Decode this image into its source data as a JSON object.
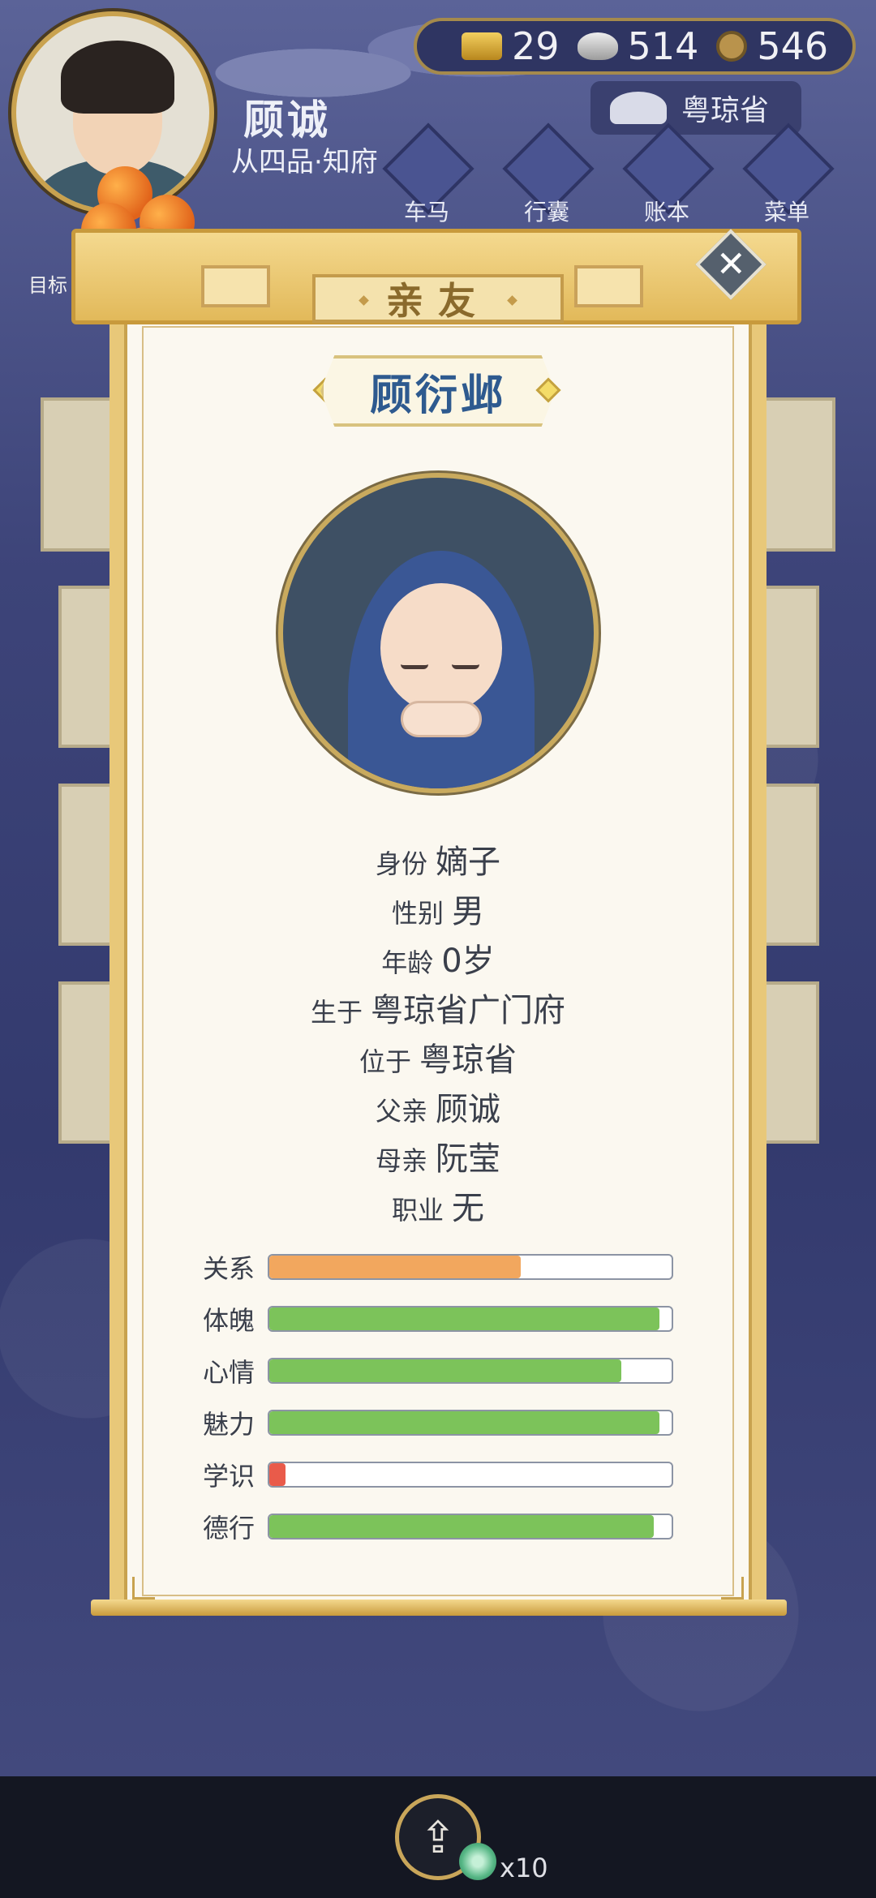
{
  "player": {
    "name": "顾诚",
    "rank": "从四品·知府",
    "goal_label": "目标"
  },
  "currency": {
    "gold": "29",
    "silver": "514",
    "coins": "546"
  },
  "location": "粤琼省",
  "menu": [
    {
      "label": "车马",
      "icon": "carriage-icon"
    },
    {
      "label": "行囊",
      "icon": "bag-icon"
    },
    {
      "label": "账本",
      "icon": "ledger-icon"
    },
    {
      "label": "菜单",
      "icon": "more-icon"
    }
  ],
  "modal": {
    "title": "亲友",
    "close_label": "✕",
    "relative_name": "顾衍邺",
    "info": [
      {
        "key": "身份",
        "value": "嫡子"
      },
      {
        "key": "性别",
        "value": "男"
      },
      {
        "key": "年龄",
        "value": "0岁"
      },
      {
        "key": "生于",
        "value": "粤琼省广门府"
      },
      {
        "key": "位于",
        "value": "粤琼省"
      },
      {
        "key": "父亲",
        "value": "顾诚"
      },
      {
        "key": "母亲",
        "value": "阮莹"
      },
      {
        "key": "职业",
        "value": "无"
      }
    ],
    "stats": [
      {
        "label": "关系",
        "level": 0.625,
        "color": "#f2a75e"
      },
      {
        "label": "体魄",
        "level": 0.97,
        "color": "#7cc35a"
      },
      {
        "label": "心情",
        "level": 0.875,
        "color": "#7cc35a"
      },
      {
        "label": "魅力",
        "level": 0.97,
        "color": "#7cc35a"
      },
      {
        "label": "学识",
        "level": 0.04,
        "color": "#e95b4a"
      },
      {
        "label": "德行",
        "level": 0.955,
        "color": "#7cc35a"
      }
    ]
  },
  "footer": {
    "share_count": "x10"
  }
}
